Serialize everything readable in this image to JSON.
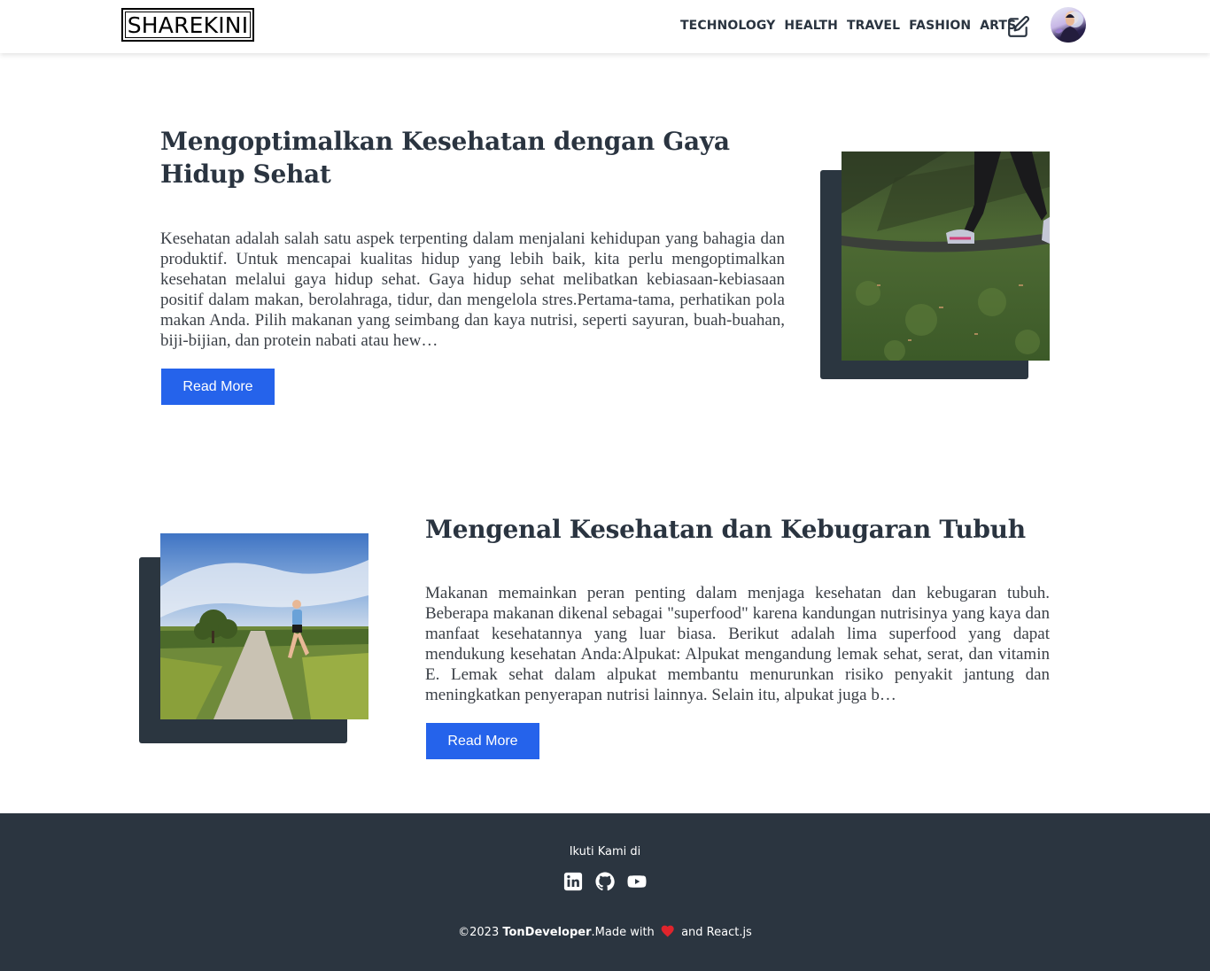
{
  "header": {
    "logo": "SHAREKINI",
    "nav": [
      "TECHNOLOGY",
      "HEALTH",
      "TRAVEL",
      "FASHION",
      "ARTS"
    ],
    "write_icon": "edit-icon",
    "avatar_icon": "user-avatar"
  },
  "articles": [
    {
      "title": "Mengoptimalkan Kesehatan dengan Gaya Hidup Sehat",
      "excerpt": "Kesehatan adalah salah satu aspek terpenting dalam menjalani kehidupan yang bahagia dan produktif. Untuk mencapai kualitas hidup yang lebih baik, kita perlu mengoptimalkan kesehatan melalui gaya hidup sehat. Gaya hidup sehat melibatkan kebiasaan-kebiasaan positif dalam makan, berolahraga, tidur, dan mengelola stres.Pertama-tama, perhatikan pola makan Anda. Pilih makanan yang seimbang dan kaya nutrisi, seperti sayuran, buah-buahan, biji-bijian, dan protein nabati atau hew…",
      "button": "Read More",
      "image": "runner-legs-on-grass"
    },
    {
      "title": "Mengenal Kesehatan dan Kebugaran Tubuh",
      "excerpt": "Makanan memainkan peran penting dalam menjaga kesehatan dan kebugaran tubuh. Beberapa makanan dikenal sebagai \"superfood\" karena kandungan nutrisinya yang kaya dan manfaat kesehatannya yang luar biasa. Berikut adalah lima superfood yang dapat mendukung kesehatan Anda:Alpukat: Alpukat mengandung lemak sehat, serat, dan vitamin E. Lemak sehat dalam alpukat membantu menurunkan risiko penyakit jantung dan meningkatkan penyerapan nutrisi lainnya. Selain itu, alpukat juga b…",
      "button": "Read More",
      "image": "runner-on-country-road"
    }
  ],
  "footer": {
    "follow": "Ikuti Kami di",
    "socials": [
      "linkedin-icon",
      "github-icon",
      "youtube-icon"
    ],
    "copyright_prefix": "©2023 ",
    "brand": "TonDeveloper",
    "made_with": ".Made with ",
    "heart_icon": "heart-icon",
    "suffix": " and React.js"
  },
  "colors": {
    "button": "#2563eb",
    "dark": "#2b3540",
    "heart": "#e0242c"
  }
}
